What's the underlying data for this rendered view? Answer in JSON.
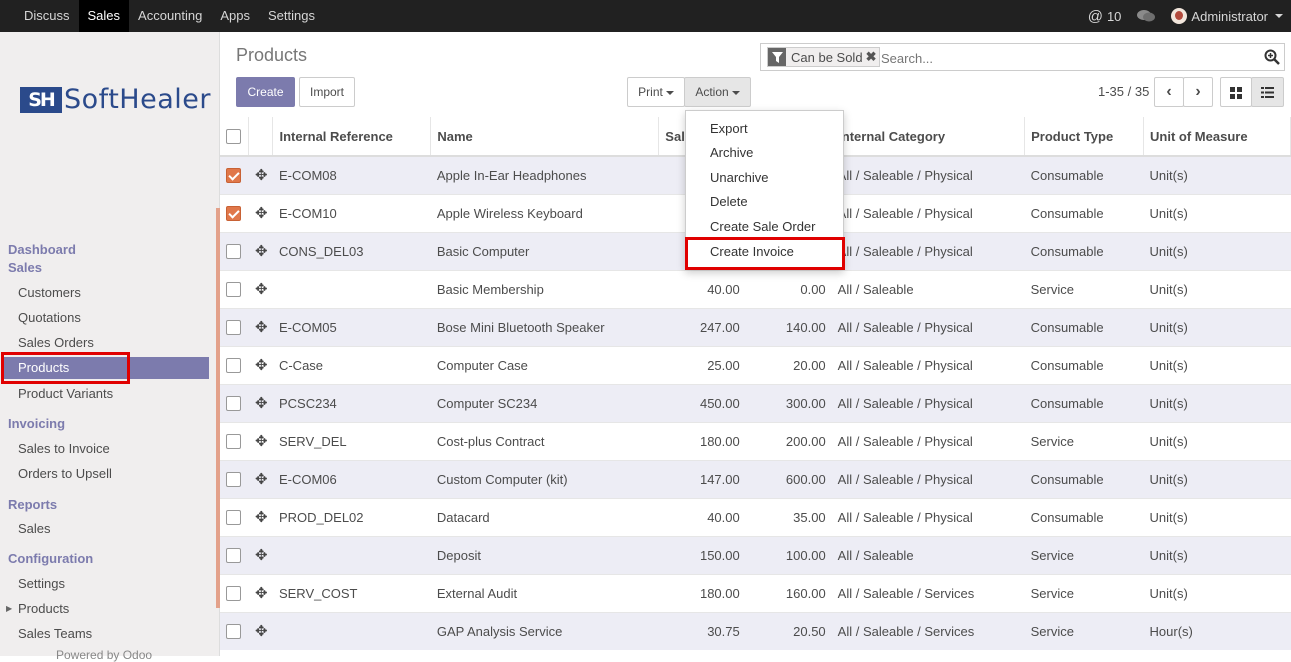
{
  "topbar": {
    "menu": [
      "Discuss",
      "Sales",
      "Accounting",
      "Apps",
      "Settings"
    ],
    "active": "Sales",
    "notifications": "10",
    "user": "Administrator"
  },
  "sidebar": {
    "logo_mark": "SH",
    "logo_text": "SoftHealer",
    "dashboard": "Dashboard",
    "sales_section": "Sales",
    "customers": "Customers",
    "quotations": "Quotations",
    "sales_orders": "Sales Orders",
    "products": "Products",
    "product_variants": "Product Variants",
    "invoicing_section": "Invoicing",
    "sales_to_invoice": "Sales to Invoice",
    "orders_to_upsell": "Orders to Upsell",
    "reports_section": "Reports",
    "reports_sales": "Sales",
    "configuration_section": "Configuration",
    "settings": "Settings",
    "config_products": "Products",
    "sales_teams": "Sales Teams",
    "powered_by": "Powered by Odoo"
  },
  "content": {
    "breadcrumb": "Products",
    "create_label": "Create",
    "import_label": "Import",
    "print_label": "Print",
    "action_label": "Action",
    "pager": "1-35 / 35"
  },
  "search": {
    "facet": "Can be Sold",
    "placeholder": "Search..."
  },
  "action_menu": {
    "items": [
      "Export",
      "Archive",
      "Unarchive",
      "Delete",
      "Create Sale Order",
      "Create Invoice"
    ]
  },
  "table": {
    "headers": [
      "Internal Reference",
      "Name",
      "Sal",
      "",
      "Internal Category",
      "Product Type",
      "Unit of Measure"
    ],
    "rows": [
      {
        "ref": "E-COM08",
        "name": "Apple In-Ear Headphones",
        "price": "",
        "cost": "",
        "category": "All / Saleable / Physical",
        "type": "Consumable",
        "uom": "Unit(s)",
        "checked": true
      },
      {
        "ref": "E-COM10",
        "name": "Apple Wireless Keyboard",
        "price": "",
        "cost": "",
        "category": "All / Saleable / Physical",
        "type": "Consumable",
        "uom": "Unit(s)",
        "checked": true
      },
      {
        "ref": "CONS_DEL03",
        "name": "Basic Computer",
        "price": "",
        "cost": "",
        "category": "All / Saleable / Physical",
        "type": "Consumable",
        "uom": "Unit(s)",
        "checked": false
      },
      {
        "ref": "",
        "name": "Basic Membership",
        "price": "40.00",
        "cost": "0.00",
        "category": "All / Saleable",
        "type": "Service",
        "uom": "Unit(s)",
        "checked": false
      },
      {
        "ref": "E-COM05",
        "name": "Bose Mini Bluetooth Speaker",
        "price": "247.00",
        "cost": "140.00",
        "category": "All / Saleable / Physical",
        "type": "Consumable",
        "uom": "Unit(s)",
        "checked": false
      },
      {
        "ref": "C-Case",
        "name": "Computer Case",
        "price": "25.00",
        "cost": "20.00",
        "category": "All / Saleable / Physical",
        "type": "Consumable",
        "uom": "Unit(s)",
        "checked": false
      },
      {
        "ref": "PCSC234",
        "name": "Computer SC234",
        "price": "450.00",
        "cost": "300.00",
        "category": "All / Saleable / Physical",
        "type": "Consumable",
        "uom": "Unit(s)",
        "checked": false
      },
      {
        "ref": "SERV_DEL",
        "name": "Cost-plus Contract",
        "price": "180.00",
        "cost": "200.00",
        "category": "All / Saleable / Physical",
        "type": "Service",
        "uom": "Unit(s)",
        "checked": false
      },
      {
        "ref": "E-COM06",
        "name": "Custom Computer (kit)",
        "price": "147.00",
        "cost": "600.00",
        "category": "All / Saleable / Physical",
        "type": "Consumable",
        "uom": "Unit(s)",
        "checked": false
      },
      {
        "ref": "PROD_DEL02",
        "name": "Datacard",
        "price": "40.00",
        "cost": "35.00",
        "category": "All / Saleable / Physical",
        "type": "Consumable",
        "uom": "Unit(s)",
        "checked": false
      },
      {
        "ref": "",
        "name": "Deposit",
        "price": "150.00",
        "cost": "100.00",
        "category": "All / Saleable",
        "type": "Service",
        "uom": "Unit(s)",
        "checked": false
      },
      {
        "ref": "SERV_COST",
        "name": "External Audit",
        "price": "180.00",
        "cost": "160.00",
        "category": "All / Saleable / Services",
        "type": "Service",
        "uom": "Unit(s)",
        "checked": false
      },
      {
        "ref": "",
        "name": "GAP Analysis Service",
        "price": "30.75",
        "cost": "20.50",
        "category": "All / Saleable / Services",
        "type": "Service",
        "uom": "Hour(s)",
        "checked": false
      }
    ]
  },
  "colors": {
    "accent": "#7c7bad",
    "highlight": "#e00000",
    "checkbox": "#e0774a"
  }
}
